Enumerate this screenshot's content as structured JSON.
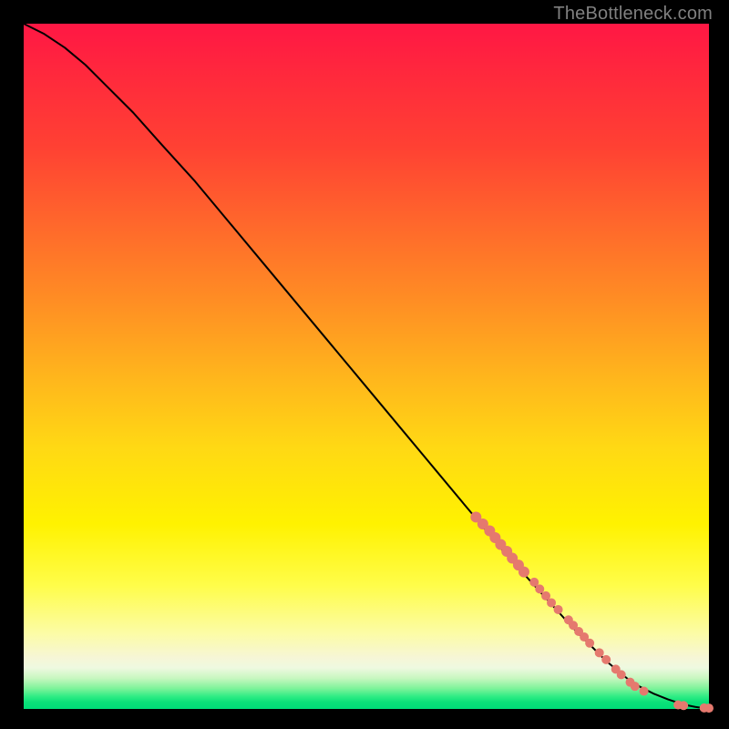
{
  "watermark": "TheBottleneck.com",
  "colors": {
    "line": "#000000",
    "marker_fill": "#e5796e",
    "marker_stroke": "#d86b60"
  },
  "chart_data": {
    "type": "line",
    "title": "",
    "xlabel": "",
    "ylabel": "",
    "xlim": [
      0,
      100
    ],
    "ylim": [
      0,
      100
    ],
    "grid": false,
    "legend": false,
    "series": [
      {
        "name": "curve",
        "x": [
          0,
          3,
          6,
          9,
          12,
          16,
          20,
          25,
          30,
          35,
          40,
          45,
          50,
          55,
          60,
          65,
          70,
          75,
          80,
          85,
          88,
          90,
          92,
          94,
          95.5,
          97,
          98,
          99,
          100
        ],
        "y": [
          100,
          98.5,
          96.5,
          94,
          91,
          87,
          82.5,
          77,
          71,
          65,
          59,
          53,
          47,
          41,
          35,
          29,
          23,
          17.5,
          12,
          7,
          4.5,
          3.2,
          2.2,
          1.4,
          0.9,
          0.5,
          0.3,
          0.15,
          0.1
        ]
      }
    ],
    "markers": [
      {
        "x": 66.0,
        "y": 28.0,
        "r": 6
      },
      {
        "x": 67.0,
        "y": 27.0,
        "r": 6
      },
      {
        "x": 68.0,
        "y": 26.0,
        "r": 6
      },
      {
        "x": 68.8,
        "y": 25.0,
        "r": 6
      },
      {
        "x": 69.6,
        "y": 24.0,
        "r": 6
      },
      {
        "x": 70.5,
        "y": 23.0,
        "r": 6
      },
      {
        "x": 71.3,
        "y": 22.0,
        "r": 6
      },
      {
        "x": 72.2,
        "y": 21.0,
        "r": 6
      },
      {
        "x": 73.0,
        "y": 20.0,
        "r": 6
      },
      {
        "x": 74.5,
        "y": 18.5,
        "r": 5
      },
      {
        "x": 75.3,
        "y": 17.5,
        "r": 5
      },
      {
        "x": 76.2,
        "y": 16.5,
        "r": 5
      },
      {
        "x": 77.0,
        "y": 15.5,
        "r": 5
      },
      {
        "x": 78.0,
        "y": 14.5,
        "r": 5
      },
      {
        "x": 79.5,
        "y": 13.0,
        "r": 5
      },
      {
        "x": 80.2,
        "y": 12.2,
        "r": 5
      },
      {
        "x": 81.0,
        "y": 11.3,
        "r": 5
      },
      {
        "x": 81.8,
        "y": 10.5,
        "r": 5
      },
      {
        "x": 82.6,
        "y": 9.6,
        "r": 5
      },
      {
        "x": 84.0,
        "y": 8.2,
        "r": 5
      },
      {
        "x": 85.0,
        "y": 7.2,
        "r": 5
      },
      {
        "x": 86.4,
        "y": 5.8,
        "r": 5
      },
      {
        "x": 87.2,
        "y": 5.0,
        "r": 5
      },
      {
        "x": 88.5,
        "y": 3.9,
        "r": 5
      },
      {
        "x": 89.2,
        "y": 3.3,
        "r": 5
      },
      {
        "x": 90.5,
        "y": 2.6,
        "r": 5
      },
      {
        "x": 95.5,
        "y": 0.6,
        "r": 5
      },
      {
        "x": 96.3,
        "y": 0.5,
        "r": 5
      },
      {
        "x": 99.3,
        "y": 0.15,
        "r": 5
      },
      {
        "x": 100.0,
        "y": 0.12,
        "r": 5
      }
    ]
  }
}
